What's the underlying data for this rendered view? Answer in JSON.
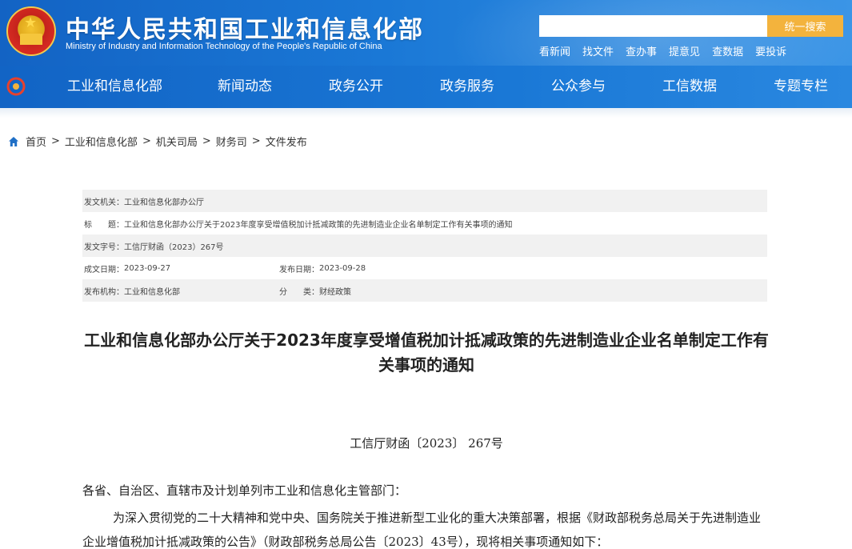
{
  "header": {
    "title": "中华人民共和国工业和信息化部",
    "subtitle": "Ministry of Industry and Information Technology of the People's Republic of China",
    "search_placeholder": "",
    "search_button": "统一搜索",
    "quick_links": [
      "看新闻",
      "找文件",
      "查办事",
      "提意见",
      "查数据",
      "要投诉"
    ]
  },
  "nav": {
    "items": [
      "工业和信息化部",
      "新闻动态",
      "政务公开",
      "政务服务",
      "公众参与",
      "工信数据",
      "专题专栏"
    ]
  },
  "breadcrumb": [
    "首页",
    "工业和信息化部",
    "机关司局",
    "财务司",
    "文件发布"
  ],
  "meta": {
    "issuer_label": "发文机关：",
    "issuer": "工业和信息化部办公厅",
    "title_label": "标　　题：",
    "title": "工业和信息化部办公厅关于2023年度享受增值税加计抵减政策的先进制造业企业名单制定工作有关事项的通知",
    "docno_label": "发文字号：",
    "docno": "工信厅财函（2023）267号",
    "written_label": "成文日期：",
    "written": "2023-09-27",
    "published_label": "发布日期：",
    "published": "2023-09-28",
    "org_label": "发布机构：",
    "org": "工业和信息化部",
    "category_label": "分　　类：",
    "category": "财经政策"
  },
  "article": {
    "title": "工业和信息化部办公厅关于2023年度享受增值税加计抵减政策的先进制造业企业名单制定工作有关事项的通知",
    "doc_number": "工信厅财函〔2023〕 267号",
    "addressee": "各省、自治区、直辖市及计划单列市工业和信息化主管部门：",
    "paragraph": "为深入贯彻党的二十大精神和党中央、国务院关于推进新型工业化的重大决策部署，根据《财政部税务总局关于先进制造业企业增值税加计抵减政策的公告》（财政部税务总局公告〔2023〕43号），现将相关事项通知如下："
  },
  "colors": {
    "header_blue": "#1a78d6",
    "search_button": "#f3b33d",
    "meta_shade": "#f1f1f1"
  }
}
